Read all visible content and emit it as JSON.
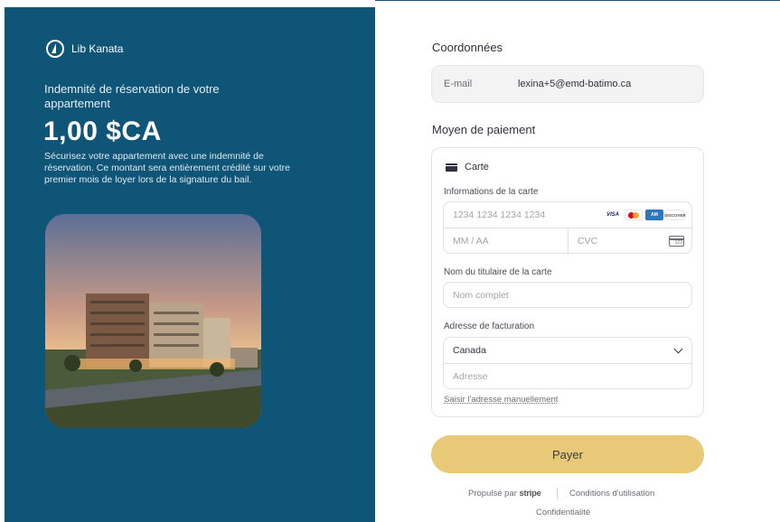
{
  "brand": {
    "name": "Lib Kanata",
    "logo_icon": "sail-logo-icon"
  },
  "summary": {
    "subtitle": "Indemnité de réservation de votre appartement",
    "amount": "1,00 $CA",
    "description": "Sécurisez votre appartement avec une indemnité de réservation. Ce montant sera entièrement crédité sur votre premier mois de loyer lors de la signature du bail."
  },
  "contact": {
    "title": "Coordonnées",
    "email_label": "E-mail",
    "email_value": "lexina+5@emd-batimo.ca"
  },
  "payment": {
    "title": "Moyen de paiement",
    "tab_label": "Carte",
    "card_info_label": "Informations de la carte",
    "card_number_placeholder": "1234 1234 1234 1234",
    "card_brands": [
      "VISA",
      "Mastercard",
      "Amex",
      "DISCOVER"
    ],
    "expiry_placeholder": "MM / AA",
    "cvc_placeholder": "CVC",
    "cvc_icon_text": "123",
    "holder_label": "Nom du titulaire de la carte",
    "holder_placeholder": "Nom complet",
    "billing_label": "Adresse de facturation",
    "country_value": "Canada",
    "address_placeholder": "Adresse",
    "manual_link": "Saisir l'adresse manuellement"
  },
  "pay_button": "Payer",
  "footer": {
    "powered_prefix": "Propulsé par",
    "powered_brand": "stripe",
    "terms": "Conditions d'utilisation",
    "privacy": "Confidentialité"
  },
  "colors": {
    "left_panel": "#0f5577",
    "pay_button": "#e8c978"
  }
}
